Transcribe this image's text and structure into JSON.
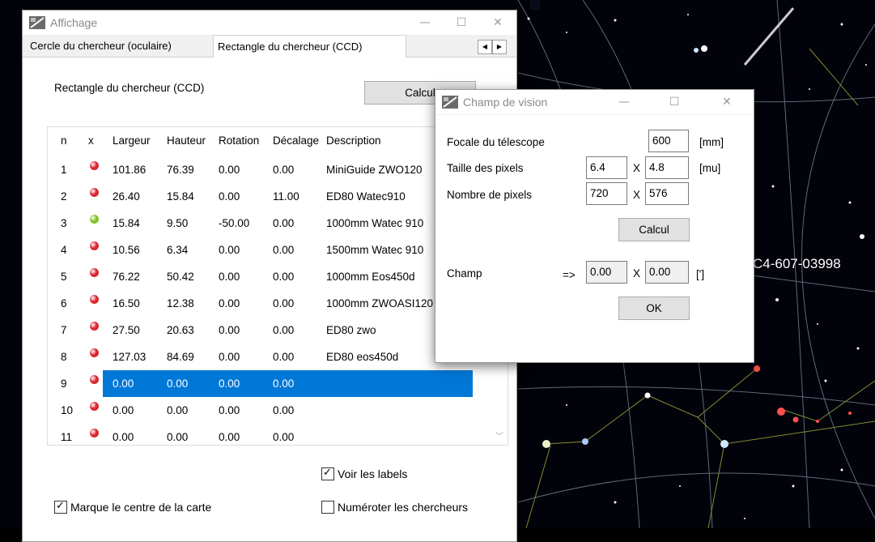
{
  "sky": {
    "label": "C4-607-03998"
  },
  "affichage": {
    "title": "Affichage",
    "tabs": [
      "Cercle du chercheur (oculaire)",
      "Rectangle du chercheur (CCD)"
    ],
    "section_label": "Rectangle du chercheur (CCD)",
    "calc_button": "Calcul",
    "columns": [
      "n",
      "x",
      "Largeur",
      "Hauteur",
      "Rotation",
      "Décalage",
      "Description"
    ],
    "rows": [
      {
        "n": "1",
        "status": "red",
        "largeur": "101.86",
        "hauteur": "76.39",
        "rotation": "0.00",
        "decalage": "0.00",
        "description": "MiniGuide ZWO120"
      },
      {
        "n": "2",
        "status": "red",
        "largeur": "26.40",
        "hauteur": "15.84",
        "rotation": "0.00",
        "decalage": "11.00",
        "description": "ED80 Watec910"
      },
      {
        "n": "3",
        "status": "green",
        "largeur": "15.84",
        "hauteur": "9.50",
        "rotation": "-50.00",
        "decalage": "0.00",
        "description": "1000mm Watec 910"
      },
      {
        "n": "4",
        "status": "red",
        "largeur": "10.56",
        "hauteur": "6.34",
        "rotation": "0.00",
        "decalage": "0.00",
        "description": "1500mm Watec 910"
      },
      {
        "n": "5",
        "status": "red",
        "largeur": "76.22",
        "hauteur": "50.42",
        "rotation": "0.00",
        "decalage": "0.00",
        "description": "1000mm Eos450d"
      },
      {
        "n": "6",
        "status": "red",
        "largeur": "16.50",
        "hauteur": "12.38",
        "rotation": "0.00",
        "decalage": "0.00",
        "description": "1000mm ZWOASI120"
      },
      {
        "n": "7",
        "status": "red",
        "largeur": "27.50",
        "hauteur": "20.63",
        "rotation": "0.00",
        "decalage": "0.00",
        "description": "ED80 zwo"
      },
      {
        "n": "8",
        "status": "red",
        "largeur": "127.03",
        "hauteur": "84.69",
        "rotation": "0.00",
        "decalage": "0.00",
        "description": "ED80 eos450d"
      },
      {
        "n": "9",
        "status": "red",
        "largeur": "0.00",
        "hauteur": "0.00",
        "rotation": "0.00",
        "decalage": "0.00",
        "description": ""
      },
      {
        "n": "10",
        "status": "red",
        "largeur": "0.00",
        "hauteur": "0.00",
        "rotation": "0.00",
        "decalage": "0.00",
        "description": ""
      },
      {
        "n": "11",
        "status": "red",
        "largeur": "0.00",
        "hauteur": "0.00",
        "rotation": "0.00",
        "decalage": "0.00",
        "description": ""
      }
    ],
    "selected_row": 9,
    "voir_labels": {
      "label": "Voir les labels",
      "checked": true
    },
    "marque_centre": {
      "label": "Marque le centre de la carte",
      "checked": true
    },
    "numeroter": {
      "label": "Numéroter les chercheurs",
      "checked": false
    }
  },
  "champ": {
    "title": "Champ de vision",
    "focale_label": "Focale du télescope",
    "focale_value": "600",
    "focale_unit": "[mm]",
    "taille_label": "Taille des pixels",
    "taille_x": "6.4",
    "taille_y": "4.8",
    "taille_unit": "[mu]",
    "nombre_label": "Nombre de pixels",
    "nombre_x": "720",
    "nombre_y": "576",
    "times": "X",
    "calc_button": "Calcul",
    "champ_label": "Champ",
    "arrow": "=>",
    "champ_x": "0.00",
    "champ_y": "0.00",
    "champ_unit": "[']",
    "ok_button": "OK"
  },
  "colors": {
    "selection": "#0078d7",
    "dot_red": "#d9262f",
    "dot_green": "#7ec423"
  }
}
